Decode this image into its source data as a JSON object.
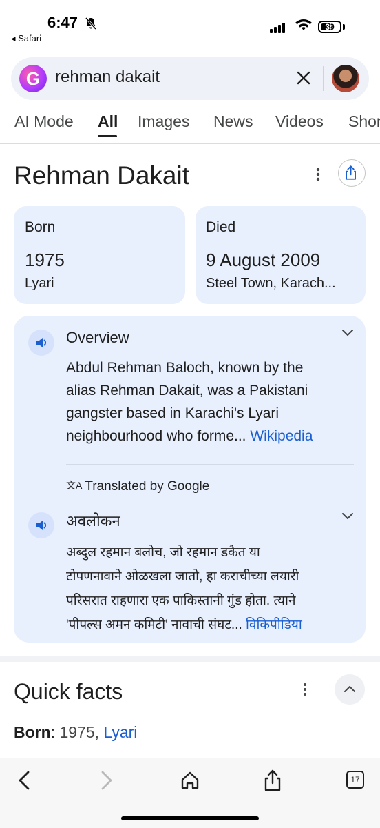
{
  "status_bar": {
    "time": "6:47",
    "back_app": "◂ Safari",
    "battery": "39"
  },
  "search": {
    "query": "rehman dakait"
  },
  "tabs": [
    {
      "label": "AI Mode"
    },
    {
      "label": "All"
    },
    {
      "label": "Images"
    },
    {
      "label": "News"
    },
    {
      "label": "Videos"
    },
    {
      "label": "Shor"
    }
  ],
  "entity": {
    "title": "Rehman Dakait"
  },
  "facts": {
    "born": {
      "label": "Born",
      "value": "1975",
      "place": "Lyari"
    },
    "died": {
      "label": "Died",
      "value": "9 August 2009",
      "place": "Steel Town, Karach..."
    }
  },
  "overview": {
    "heading": "Overview",
    "lines": [
      "Abdul Rehman Baloch, known by the",
      "alias Rehman Dakait, was a Pakistani",
      "gangster based in Karachi's Lyari",
      "neighbourhood who forme..."
    ],
    "link": "Wikipedia"
  },
  "translated": {
    "note": "Translated by Google",
    "heading": "अवलोकन",
    "lines": [
      "अब्दुल रहमान बलोच, जो रहमान डकैत या",
      "टोपणनावाने ओळखला जातो, हा कराचीच्या लयारी",
      "परिसरात राहणारा एक पाकिस्तानी गुंड होता. त्याने",
      "'पीपल्स अमन कमिटी' नावाची संघट..."
    ],
    "link": "विकिपीडिया"
  },
  "quick_facts": {
    "title": "Quick facts",
    "born_label": "Born",
    "born_value": "1975,",
    "born_place": "Lyari"
  },
  "toolbar": {
    "tabs_count": "17"
  }
}
